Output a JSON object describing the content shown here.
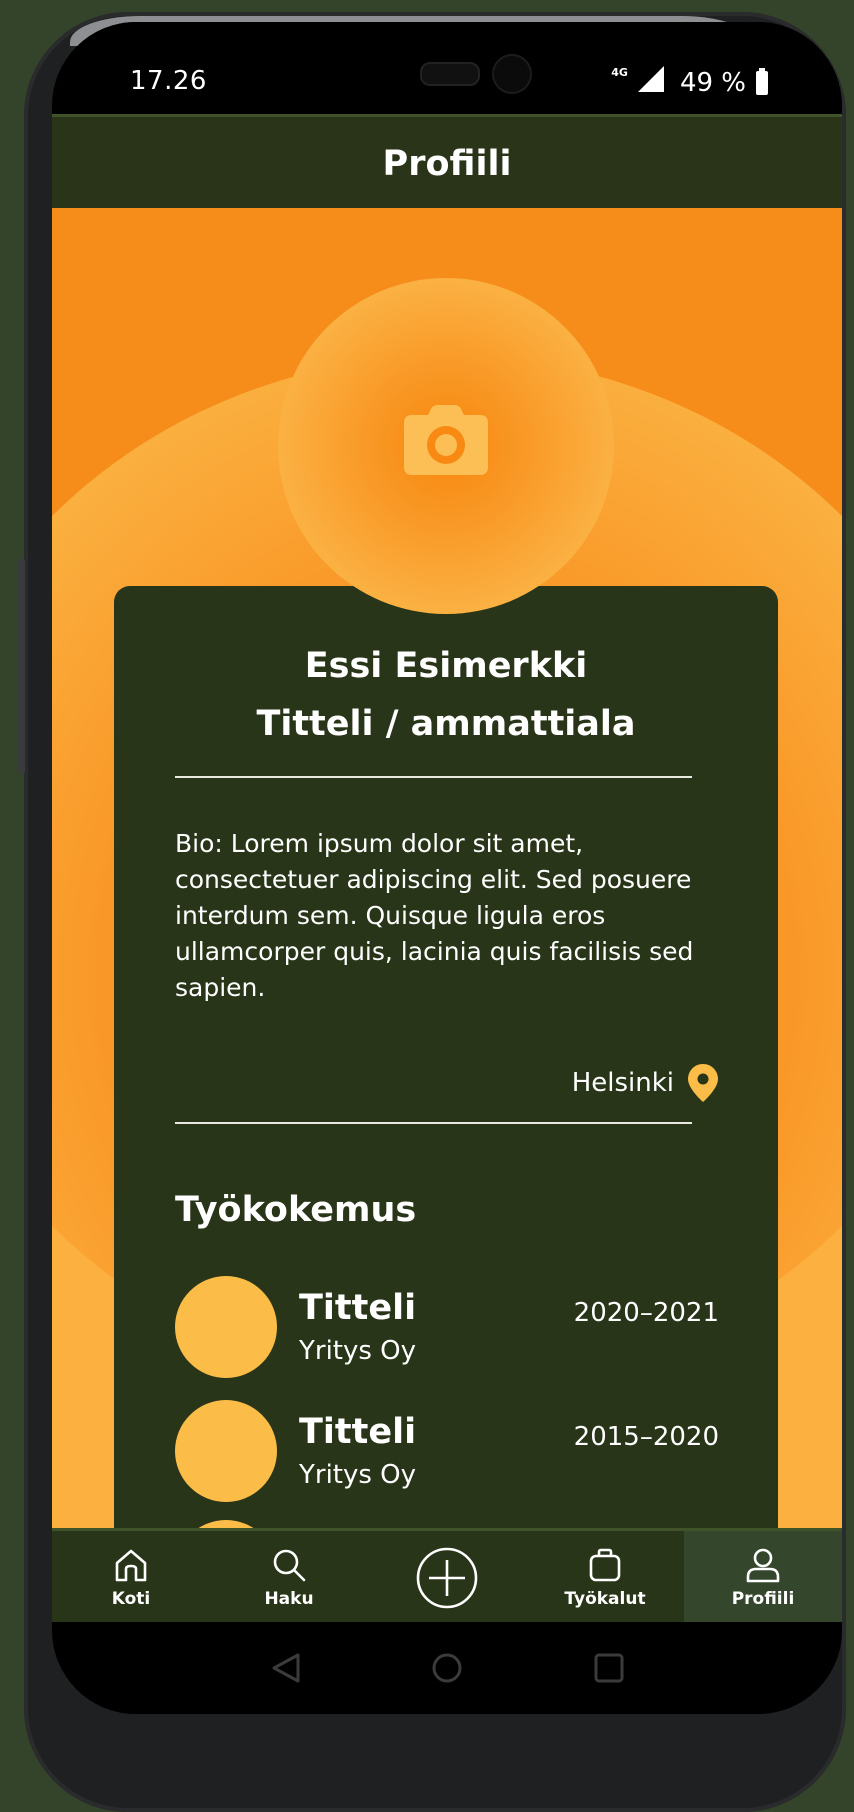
{
  "status_bar": {
    "time": "17.26",
    "network": "4G",
    "battery": "49 %"
  },
  "header": {
    "title": "Profiili"
  },
  "profile": {
    "name": "Essi Esimerkki",
    "title": "Titteli / ammattiala",
    "bio": "Bio: Lorem ipsum dolor sit amet, consectetuer adipiscing elit. Sed posuere interdum sem. Quisque ligula eros ullamcorper quis, lacinia quis facilisis sed sapien.",
    "location": "Helsinki"
  },
  "work_experience": {
    "heading": "Työkokemus",
    "items": [
      {
        "title": "Titteli",
        "company": "Yritys Oy",
        "years": "2020–2021"
      },
      {
        "title": "Titteli",
        "company": "Yritys Oy",
        "years": "2015–2020"
      }
    ]
  },
  "bottom_nav": {
    "items": [
      {
        "label": "Koti",
        "icon": "home-icon"
      },
      {
        "label": "Haku",
        "icon": "search-icon"
      },
      {
        "label": "",
        "icon": "add-circle-icon"
      },
      {
        "label": "Työkalut",
        "icon": "briefcase-icon"
      },
      {
        "label": "Profiili",
        "icon": "user-icon",
        "active": true
      }
    ]
  },
  "colors": {
    "dark_green": "#283518",
    "orange": "#f68d1b",
    "yellow": "#fbbd47"
  }
}
